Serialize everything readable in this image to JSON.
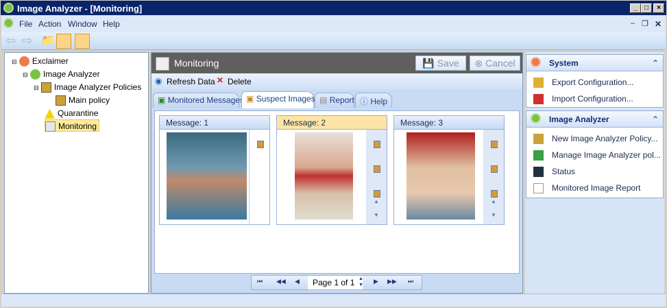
{
  "window": {
    "title": "Image Analyzer - [Monitoring]"
  },
  "menu": [
    "File",
    "Action",
    "Window",
    "Help"
  ],
  "tree": [
    "Exclaimer",
    "Image Analyzer",
    "Image Analyzer Policies",
    "Main policy",
    "Quarantine",
    "Monitoring"
  ],
  "header": {
    "title": "Monitoring",
    "save": "Save",
    "cancel": "Cancel"
  },
  "actions": {
    "refresh": "Refresh Data",
    "delete": "Delete"
  },
  "tabs": [
    "Monitored Messages",
    "Suspect Images",
    "Report",
    "Help"
  ],
  "active_tab": "Suspect Images",
  "cards": [
    {
      "label": "Message: 1"
    },
    {
      "label": "Message: 2",
      "selected": true
    },
    {
      "label": "Message: 3"
    }
  ],
  "pager": {
    "text": "Page 1 of 1"
  },
  "system": {
    "title": "System",
    "items": [
      "Export Configuration...",
      "Import Configuration..."
    ]
  },
  "analyzer": {
    "title": "Image Analyzer",
    "items": [
      "New Image Analyzer Policy...",
      "Manage Image Analyzer pol...",
      "Status",
      "Monitored Image Report"
    ]
  }
}
